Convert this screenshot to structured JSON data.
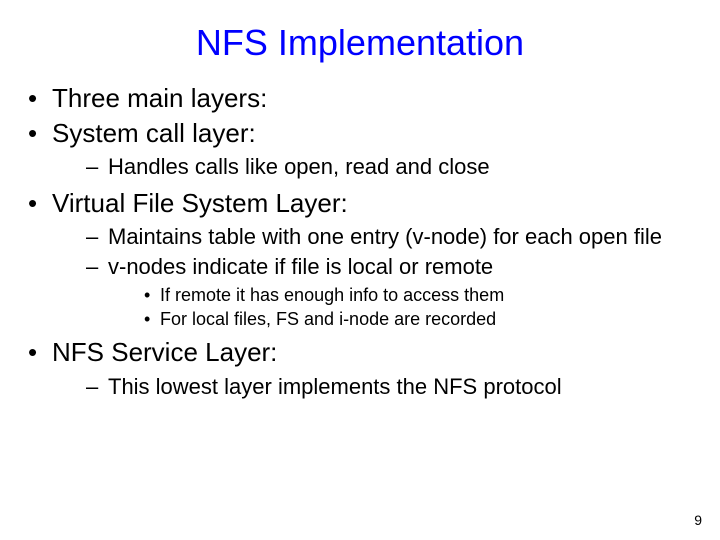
{
  "title": "NFS Implementation",
  "bullets": {
    "b0": "Three main layers:",
    "b1": "System call layer:",
    "b1_sub": {
      "s0": "Handles calls like open, read and close"
    },
    "b2": "Virtual File System Layer:",
    "b2_sub": {
      "s0": "Maintains table with one entry (v-node) for each open file",
      "s1": "v-nodes indicate if file is local or remote",
      "s1_sub": {
        "t0": "If remote it has enough info to access them",
        "t1": "For local files, FS and i-node are recorded"
      }
    },
    "b3": "NFS Service Layer:",
    "b3_sub": {
      "s0": "This lowest layer implements the NFS protocol"
    }
  },
  "page_number": "9"
}
